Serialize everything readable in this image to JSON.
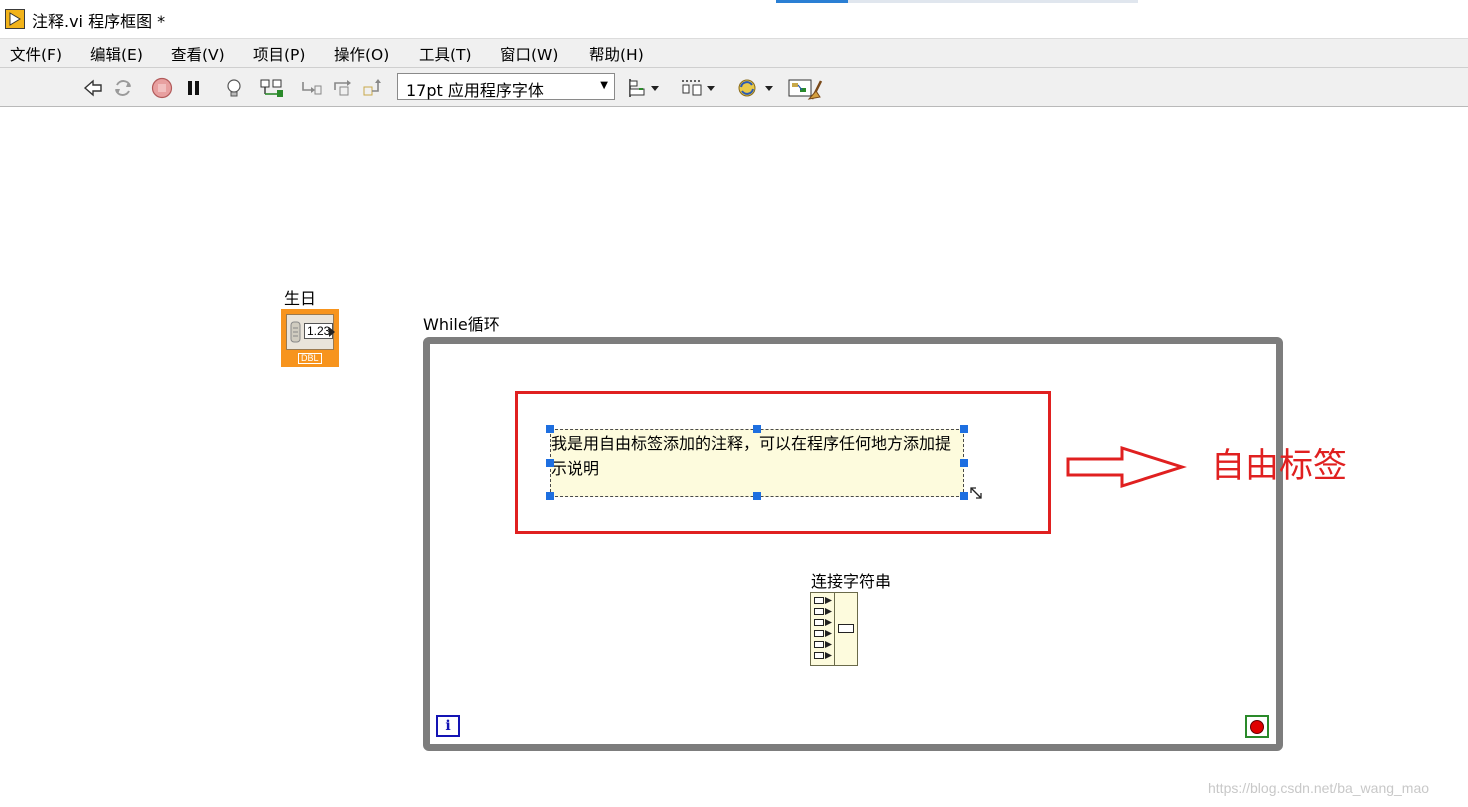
{
  "window": {
    "title": "注释.vi 程序框图 *"
  },
  "menu": {
    "items": [
      "文件(F)",
      "编辑(E)",
      "查看(V)",
      "项目(P)",
      "操作(O)",
      "工具(T)",
      "窗口(W)",
      "帮助(H)"
    ]
  },
  "toolbar": {
    "font_selector": "17pt 应用程序字体",
    "icons": [
      "run-arrow-icon",
      "run-continuously-icon",
      "abort-icon",
      "pause-icon",
      "highlight-execution-icon",
      "retain-wire-values-icon",
      "step-into-icon",
      "step-over-icon",
      "step-out-icon",
      "align-objects-icon",
      "distribute-objects-icon",
      "reorder-icon",
      "cleanup-diagram-icon"
    ]
  },
  "diagram": {
    "birthday_label": "生日",
    "birthday_value": "1.23",
    "birthday_type": "DBL",
    "loop_label": "While循环",
    "iteration_terminal": "i",
    "free_label_text": "我是用自由标签添加的注释，可以在程序任何地方添加提示说明",
    "concat_label": "连接字符串"
  },
  "annotation": {
    "text": "自由标签",
    "color": "#e02020"
  },
  "watermark": "https://blog.csdn.net/ba_wang_mao",
  "colors": {
    "numeric_orange": "#f7941d",
    "loop_gray": "#7d7d7d",
    "label_bg": "#fdfbdd",
    "selection_blue": "#1e6fe0"
  }
}
